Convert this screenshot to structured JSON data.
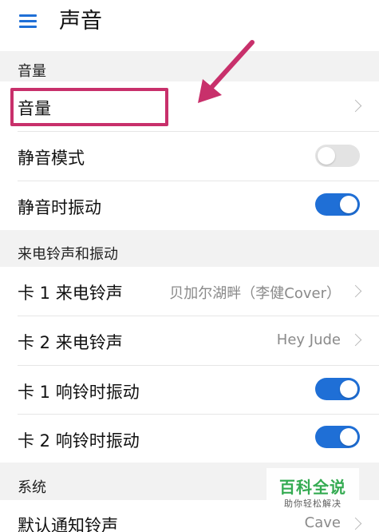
{
  "header": {
    "title": "声音",
    "menu_icon": "hamburger-menu-icon"
  },
  "sections": {
    "volume": "音量",
    "ringtone": "来电铃声和振动",
    "system": "系统"
  },
  "rows": {
    "volume": {
      "label": "音量"
    },
    "silent_mode": {
      "label": "静音模式",
      "enabled": false
    },
    "vibrate_when_silent": {
      "label": "静音时振动",
      "enabled": true
    },
    "card1_ringtone": {
      "label": "卡 1 来电铃声",
      "value": "贝加尔湖畔（李健Cover）"
    },
    "card2_ringtone": {
      "label": "卡 2 来电铃声",
      "value": "Hey Jude"
    },
    "card1_vibrate": {
      "label": "卡 1 响铃时振动",
      "enabled": true
    },
    "card2_vibrate": {
      "label": "卡 2 响铃时振动",
      "enabled": true
    },
    "notification_tone": {
      "label": "默认通知铃声",
      "value": "Cave"
    }
  },
  "annotation": {
    "color": "#c8306b"
  },
  "watermark": {
    "title": "百科全说",
    "subtitle": "助你轻松解决"
  },
  "colors": {
    "accent": "#1f6fd6",
    "section_bg": "#f2f2f2",
    "watermark_green": "#2ba84a"
  }
}
